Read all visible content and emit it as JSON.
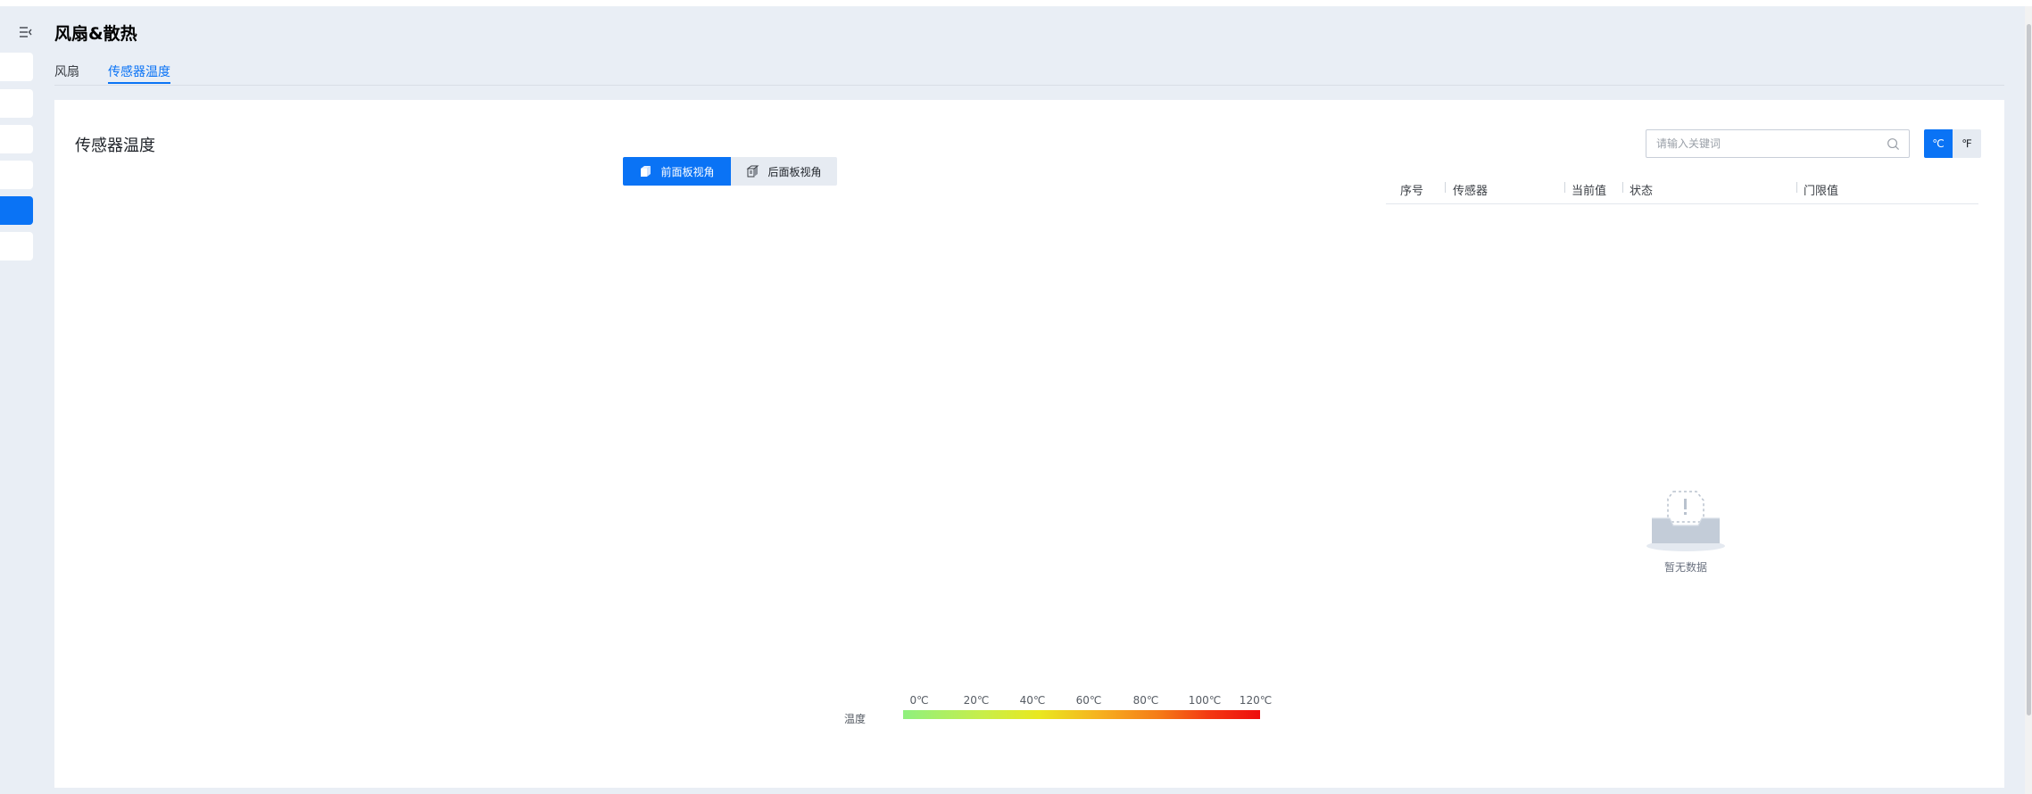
{
  "page": {
    "title": "风扇&散热"
  },
  "tabs": [
    {
      "label": "风扇",
      "active": false
    },
    {
      "label": "传感器温度",
      "active": true
    }
  ],
  "card": {
    "title": "传感器温度"
  },
  "view_toggle": {
    "front_label": "前面板视角",
    "back_label": "后面板视角",
    "selected": "front"
  },
  "search": {
    "placeholder": "请输入关键词",
    "value": ""
  },
  "units": {
    "celsius": "℃",
    "fahrenheit": "℉",
    "selected": "celsius"
  },
  "table": {
    "columns": [
      "序号",
      "传感器",
      "当前值",
      "状态",
      "门限值"
    ],
    "rows": []
  },
  "empty_state": {
    "text": "暂无数据"
  },
  "legend": {
    "label": "温度",
    "ticks": [
      "0℃",
      "20℃",
      "40℃",
      "60℃",
      "80℃",
      "100℃",
      "120℃"
    ]
  },
  "colors": {
    "accent": "#0a73f5",
    "background": "#e9eef5",
    "gradient_start": "#8ff07e",
    "gradient_end": "#ee0d0d"
  }
}
